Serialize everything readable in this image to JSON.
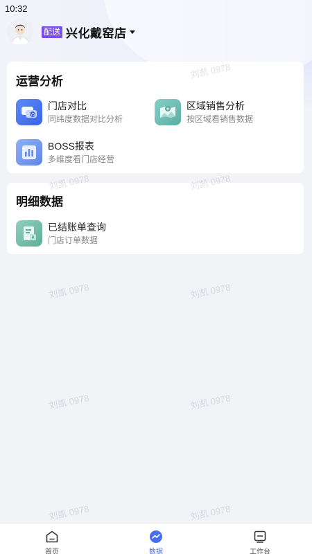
{
  "status_bar": {
    "time": "10:32"
  },
  "header": {
    "badge": "配送",
    "store_name": "兴化戴窑店"
  },
  "sections": [
    {
      "title": "运营分析",
      "items": [
        {
          "title": "门店对比",
          "subtitle": "同纬度数据对比分析",
          "icon": "store-compare-icon"
        },
        {
          "title": "区域销售分析",
          "subtitle": "按区域看销售数据",
          "icon": "map-icon"
        },
        {
          "title": "BOSS报表",
          "subtitle": "多维度看门店经营",
          "icon": "report-chart-icon"
        }
      ]
    },
    {
      "title": "明细数据",
      "items": [
        {
          "title": "已结账单查询",
          "subtitle": "门店订单数据",
          "icon": "bill-icon"
        }
      ]
    }
  ],
  "tabbar": {
    "items": [
      {
        "label": "首页",
        "icon": "home-icon",
        "active": false
      },
      {
        "label": "数据",
        "icon": "data-icon",
        "active": true
      },
      {
        "label": "工作台",
        "icon": "workbench-icon",
        "active": false
      }
    ]
  },
  "watermark": "刘凯 0978",
  "colors": {
    "accent": "#4a6ef0",
    "badge": "#7b4df1"
  }
}
